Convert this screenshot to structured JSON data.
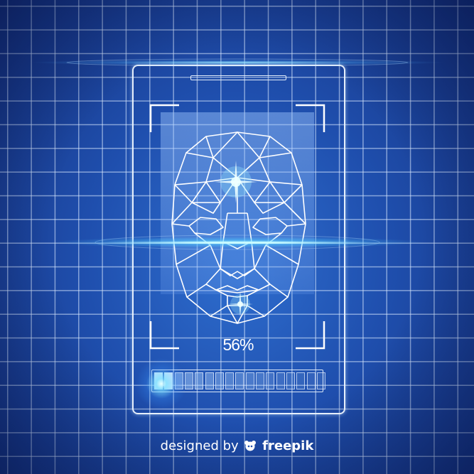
{
  "scan": {
    "percent_label": "56%",
    "progress_fraction": 0.56,
    "segments_total": 17,
    "segments_filled": 2
  },
  "credit": {
    "prefix": "designed by",
    "brand": "freepik",
    "logo_icon": "freepik-logo-icon"
  },
  "colors": {
    "background": "#1f4fae",
    "grid": "#dcebff",
    "glow": "#9ff0ff",
    "wire": "#ffffff"
  }
}
